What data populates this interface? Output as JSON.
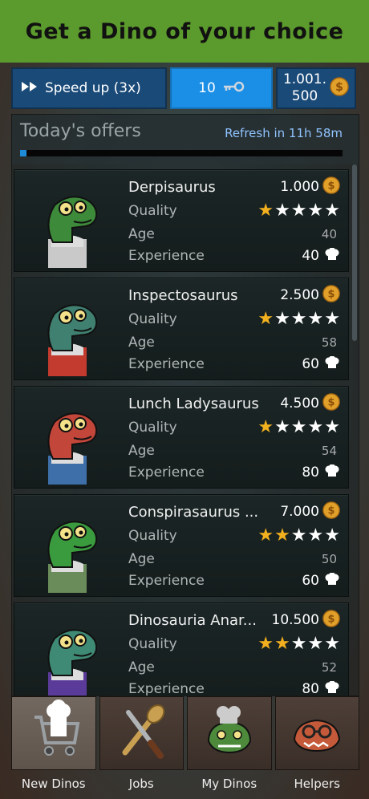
{
  "banner": {
    "title": "Get a Dino of your choice"
  },
  "topbar": {
    "speed_label": "Speed up (3x)",
    "keys": "10",
    "coins_line1": "1.001.",
    "coins_line2": "500"
  },
  "offers": {
    "title": "Today's offers",
    "refresh": "Refresh in 11h 58m",
    "progress": 0.02,
    "quality_label": "Quality",
    "age_label": "Age",
    "experience_label": "Experience",
    "items": [
      {
        "name": "Derpisaurus",
        "price": "1.000",
        "stars": 1,
        "age": "40",
        "experience": "40",
        "skin": "#3d8a3a",
        "accent": "#c9c9c9"
      },
      {
        "name": "Inspectosaurus",
        "price": "2.500",
        "stars": 1,
        "age": "58",
        "experience": "60",
        "skin": "#3f8070",
        "accent": "#c33b2e"
      },
      {
        "name": "Lunch Ladysaurus",
        "price": "4.500",
        "stars": 1,
        "age": "54",
        "experience": "80",
        "skin": "#c2463a",
        "accent": "#3f6fa8"
      },
      {
        "name": "Conspirasaurus ...",
        "price": "7.000",
        "stars": 2,
        "age": "50",
        "experience": "60",
        "skin": "#3a9a3e",
        "accent": "#6a8b5a"
      },
      {
        "name": "Dinosauria Anar...",
        "price": "10.500",
        "stars": 2,
        "age": "52",
        "experience": "80",
        "skin": "#3f8a74",
        "accent": "#5b3b9a"
      }
    ]
  },
  "nav": {
    "items": [
      {
        "label": "New Dinos",
        "icon": "cart-icon"
      },
      {
        "label": "Jobs",
        "icon": "knife-spoon-icon"
      },
      {
        "label": "My Dinos",
        "icon": "dino-chef-icon"
      },
      {
        "label": "Helpers",
        "icon": "dino-helper-icon"
      }
    ]
  },
  "colors": {
    "banner": "#5b9a2c",
    "topbar": "#1a4a78",
    "keys_active": "#1b8fe6",
    "star_on": "#f2b01e",
    "coin": "#e1a02a"
  }
}
